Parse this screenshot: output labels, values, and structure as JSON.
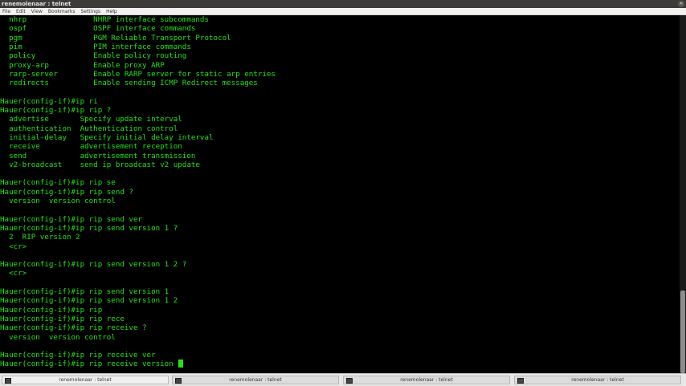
{
  "window": {
    "title": "renemolenaar : telnet"
  },
  "menu": [
    "File",
    "Edit",
    "View",
    "Bookmarks",
    "Settings",
    "Help"
  ],
  "terminal_lines": [
    "  nhrp               NHRP interface subcommands",
    "  ospf               OSPF interface commands",
    "  pgm                PGM Reliable Transport Protocol",
    "  pim                PIM interface commands",
    "  policy             Enable policy routing",
    "  proxy-arp          Enable proxy ARP",
    "  rarp-server        Enable RARP server for static arp entries",
    "  redirects          Enable sending ICMP Redirect messages",
    "",
    "Hauer(config-if)#ip ri",
    "Hauer(config-if)#ip rip ?",
    "  advertise       Specify update interval",
    "  authentication  Authentication control",
    "  initial-delay   Specify initial delay interval",
    "  receive         advertisement reception",
    "  send            advertisement transmission",
    "  v2-broadcast    send ip broadcast v2 update",
    "",
    "Hauer(config-if)#ip rip se",
    "Hauer(config-if)#ip rip send ?",
    "  version  version control",
    "",
    "Hauer(config-if)#ip rip send ver",
    "Hauer(config-if)#ip rip send version 1 ?",
    "  2  RIP version 2",
    "  <cr>",
    "",
    "Hauer(config-if)#ip rip send version 1 2 ?",
    "  <cr>",
    "",
    "Hauer(config-if)#ip rip send version 1",
    "Hauer(config-if)#ip rip send version 1 2",
    "Hauer(config-if)#ip rip",
    "Hauer(config-if)#ip rip rece",
    "Hauer(config-if)#ip rip receive ?",
    "  version  version control",
    "",
    "Hauer(config-if)#ip rip receive ver",
    "Hauer(config-if)#ip rip receive version "
  ],
  "taskbar": [
    {
      "label": "renemolenaar : telnet",
      "active": true
    },
    {
      "label": "renemolenaar : telnet",
      "active": false
    },
    {
      "label": "renemolenaar : telnet",
      "active": false
    },
    {
      "label": "renemolenaar : telnet",
      "active": false
    }
  ],
  "colors": {
    "terminal_text": "#27e11b",
    "terminal_bg": "#000000"
  },
  "icons": {
    "terminal_icon": "terminal-icon"
  }
}
